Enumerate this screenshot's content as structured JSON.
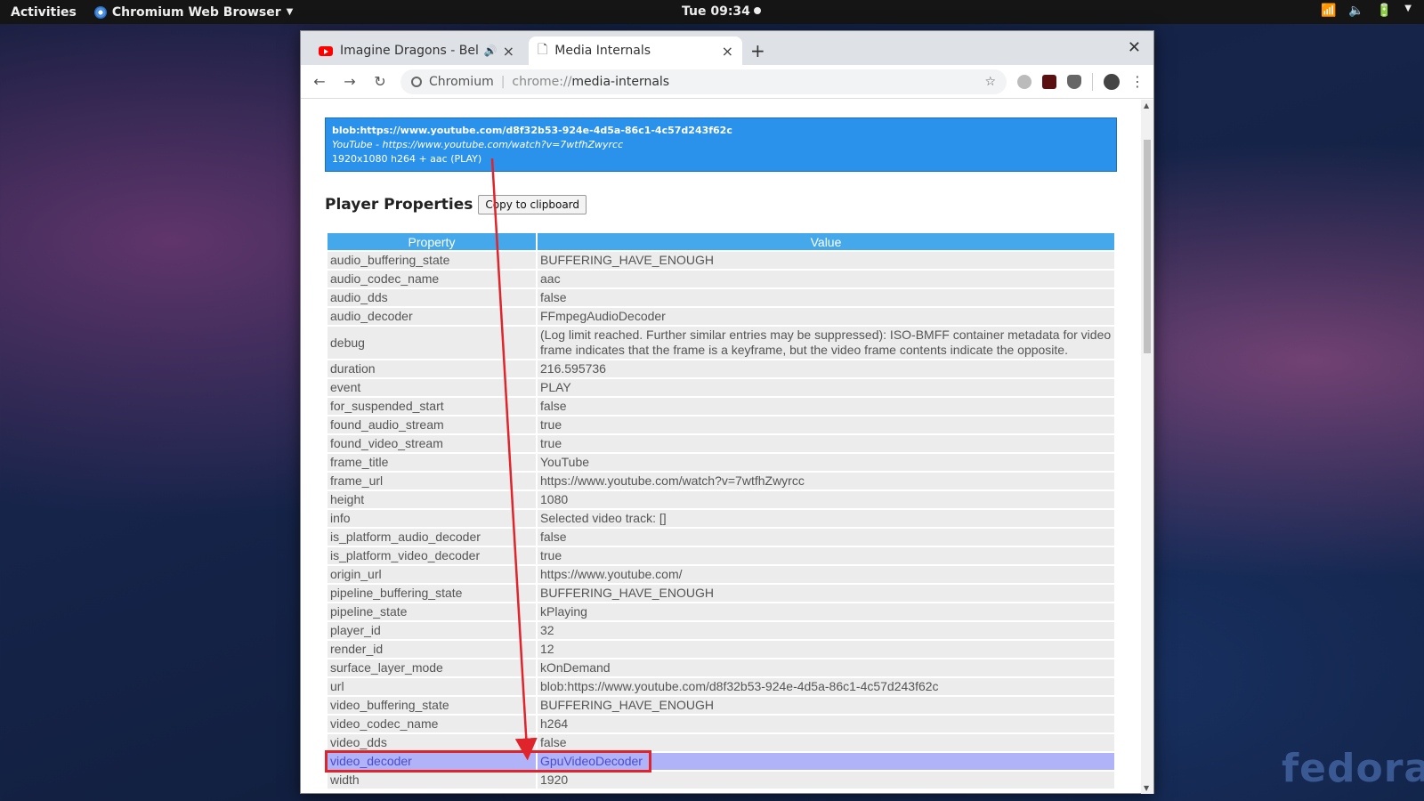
{
  "topbar": {
    "activities": "Activities",
    "app_name": "Chromium Web Browser",
    "clock": "Tue 09:34"
  },
  "tabs": [
    {
      "title": "Imagine Dragons - Bel",
      "favicon": "youtube-icon"
    },
    {
      "title": "Media Internals",
      "favicon": "document-icon"
    }
  ],
  "omnibox": {
    "chip": "Chromium",
    "scheme": "chrome://",
    "path": "media-internals"
  },
  "player": {
    "blob_url": "blob:https://www.youtube.com/d8f32b53-924e-4d5a-86c1-4c57d243f62c",
    "frame_line": "YouTube - https://www.youtube.com/watch?v=7wtfhZwyrcc",
    "summary": "1920x1080 h264 + aac (PLAY)"
  },
  "properties": {
    "heading": "Player Properties",
    "copy_button": "Copy to clipboard",
    "col_property": "Property",
    "col_value": "Value",
    "rows": [
      {
        "property": "audio_buffering_state",
        "value": "BUFFERING_HAVE_ENOUGH"
      },
      {
        "property": "audio_codec_name",
        "value": "aac"
      },
      {
        "property": "audio_dds",
        "value": "false"
      },
      {
        "property": "audio_decoder",
        "value": "FFmpegAudioDecoder"
      },
      {
        "property": "debug",
        "value": "(Log limit reached. Further similar entries may be suppressed): ISO-BMFF container metadata for video frame indicates that the frame is a keyframe, but the video frame contents indicate the opposite."
      },
      {
        "property": "duration",
        "value": "216.595736"
      },
      {
        "property": "event",
        "value": "PLAY"
      },
      {
        "property": "for_suspended_start",
        "value": "false"
      },
      {
        "property": "found_audio_stream",
        "value": "true"
      },
      {
        "property": "found_video_stream",
        "value": "true"
      },
      {
        "property": "frame_title",
        "value": "YouTube"
      },
      {
        "property": "frame_url",
        "value": "https://www.youtube.com/watch?v=7wtfhZwyrcc"
      },
      {
        "property": "height",
        "value": "1080"
      },
      {
        "property": "info",
        "value": "Selected video track: []"
      },
      {
        "property": "is_platform_audio_decoder",
        "value": "false"
      },
      {
        "property": "is_platform_video_decoder",
        "value": "true"
      },
      {
        "property": "origin_url",
        "value": "https://www.youtube.com/"
      },
      {
        "property": "pipeline_buffering_state",
        "value": "BUFFERING_HAVE_ENOUGH"
      },
      {
        "property": "pipeline_state",
        "value": "kPlaying"
      },
      {
        "property": "player_id",
        "value": "32"
      },
      {
        "property": "render_id",
        "value": "12"
      },
      {
        "property": "surface_layer_mode",
        "value": "kOnDemand"
      },
      {
        "property": "url",
        "value": "blob:https://www.youtube.com/d8f32b53-924e-4d5a-86c1-4c57d243f62c"
      },
      {
        "property": "video_buffering_state",
        "value": "BUFFERING_HAVE_ENOUGH"
      },
      {
        "property": "video_codec_name",
        "value": "h264"
      },
      {
        "property": "video_dds",
        "value": "false"
      },
      {
        "property": "video_decoder",
        "value": "GpuVideoDecoder",
        "highlighted": true
      },
      {
        "property": "width",
        "value": "1920"
      }
    ]
  },
  "wallpaper_logo": "fedora",
  "colors": {
    "player_box": "#2b92ec",
    "table_header": "#45a8ea",
    "highlight_row": "#b0b3f7",
    "annotation_red": "#e0242b"
  }
}
